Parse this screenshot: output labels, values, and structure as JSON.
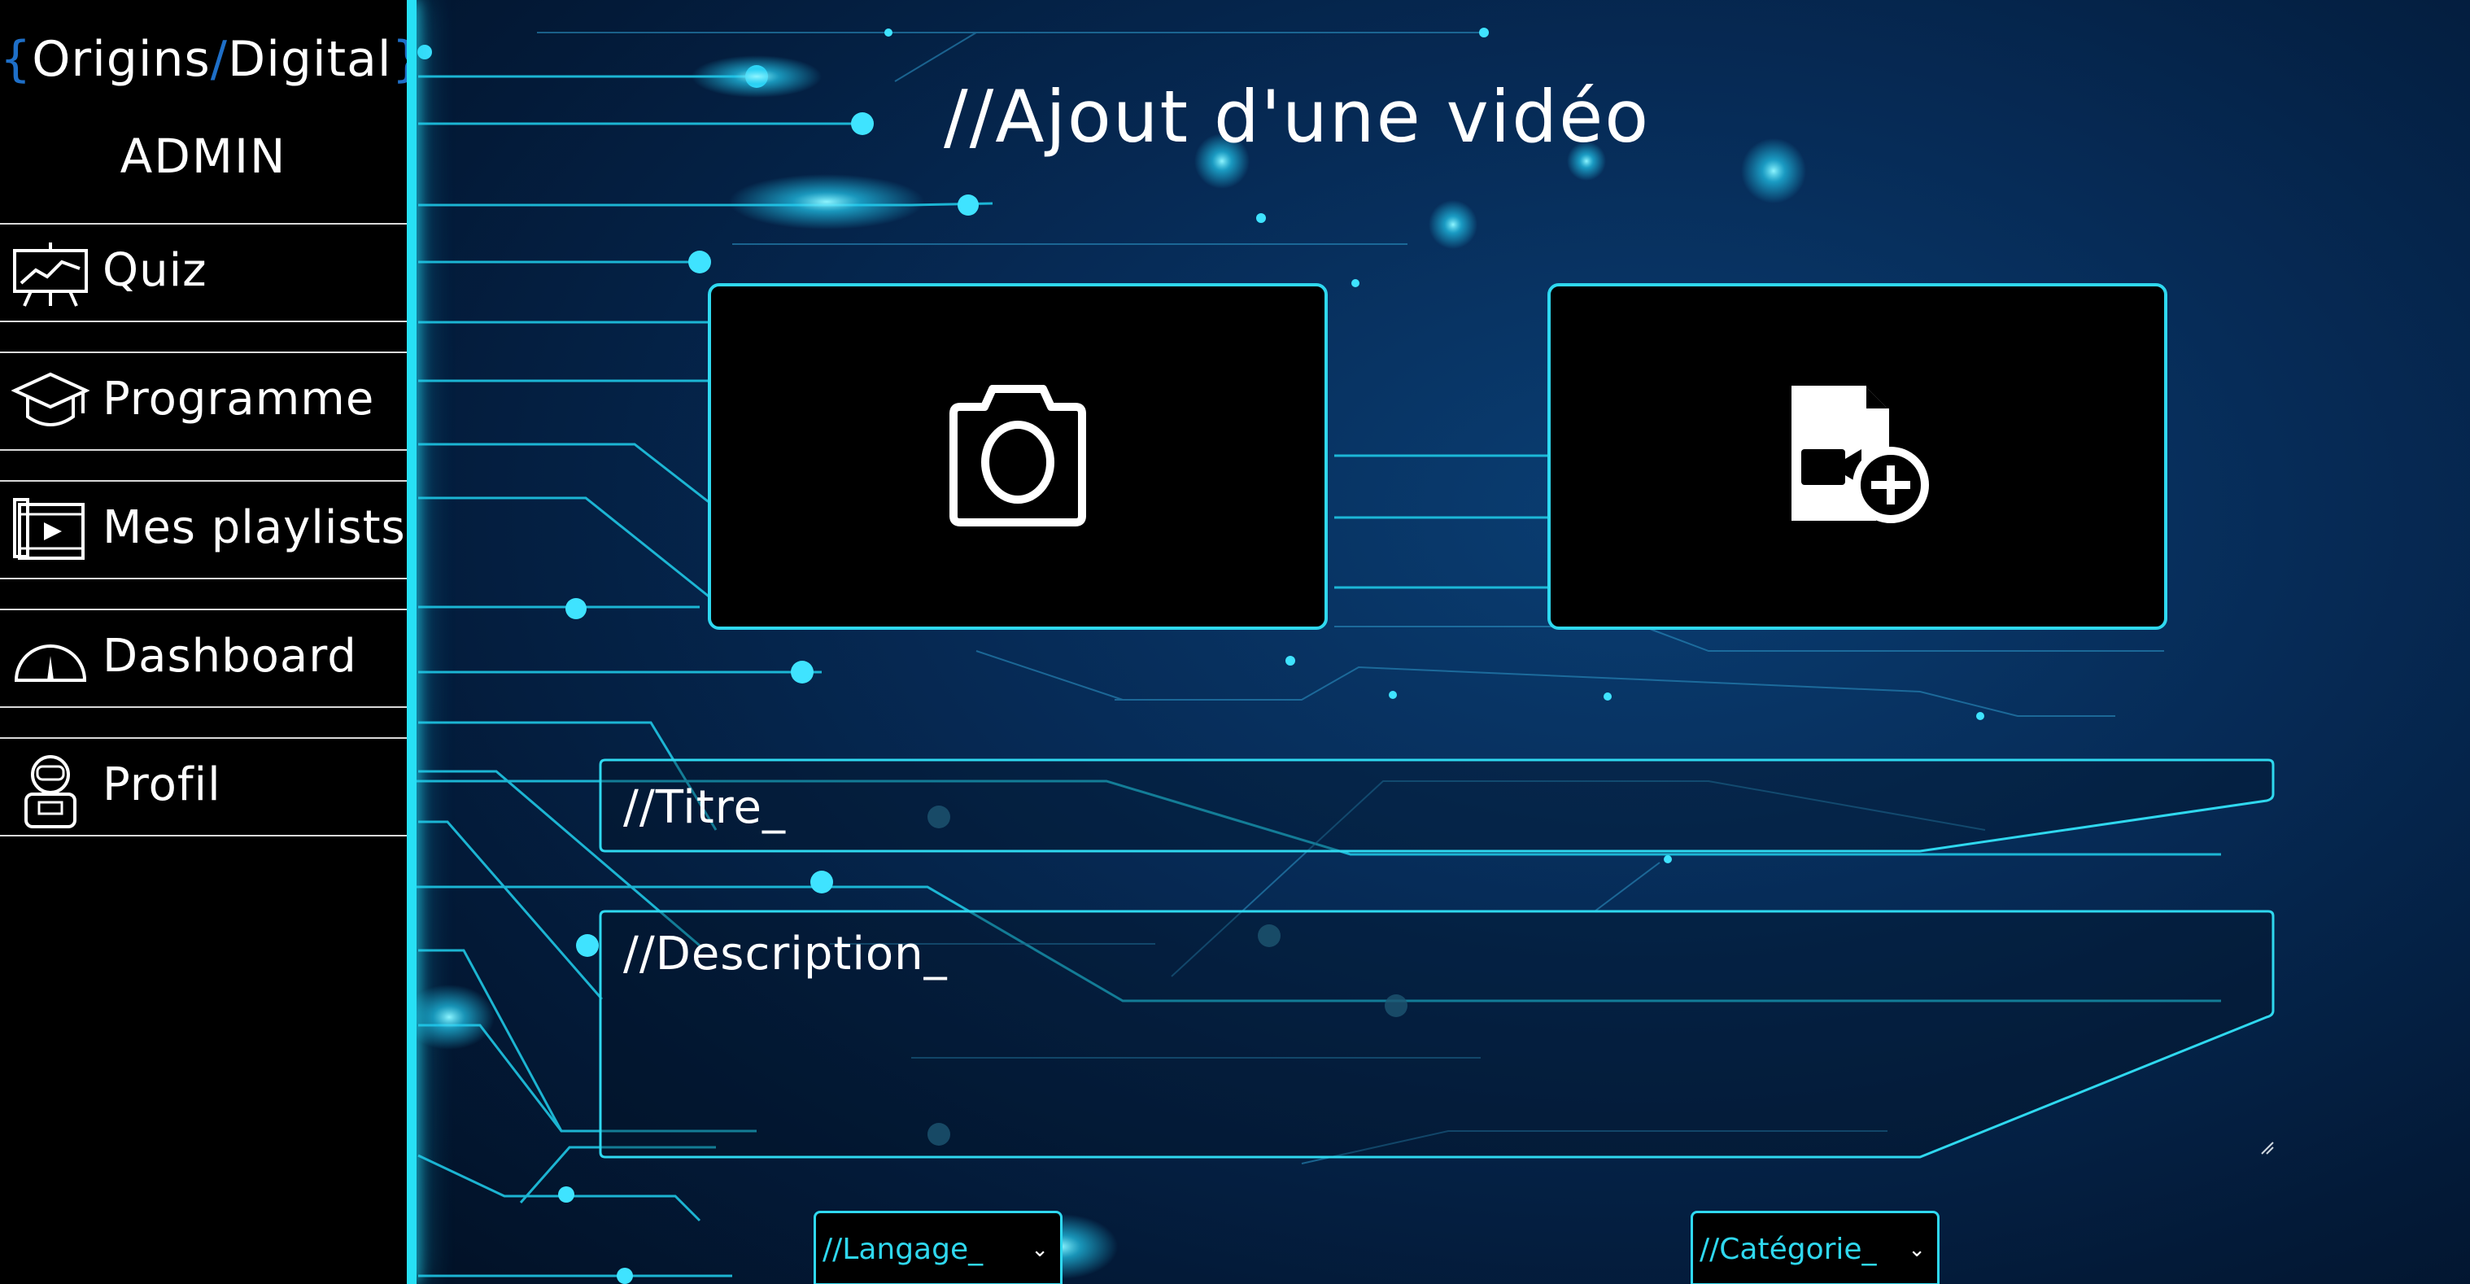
{
  "brand": {
    "brace_open": "{",
    "origins": "Origins",
    "slash": "/",
    "digital": "Digital",
    "brace_close": "}",
    "accent_color": "#1e6fc8"
  },
  "role": "ADMIN",
  "sidebar": {
    "items": [
      {
        "label": "Quiz",
        "icon": "presentation-chart-icon"
      },
      {
        "label": "Programme",
        "icon": "graduation-cap-icon"
      },
      {
        "label": "Mes playlists",
        "icon": "video-playlist-icon"
      },
      {
        "label": "Dashboard",
        "icon": "speedometer-icon"
      },
      {
        "label": "Profil",
        "icon": "astronaut-icon"
      }
    ]
  },
  "main": {
    "title": "//Ajout d'une vidéo",
    "upload_thumbnail_icon": "camera-icon",
    "upload_video_icon": "add-video-file-icon",
    "title_field": {
      "placeholder": "//Titre_"
    },
    "description_field": {
      "placeholder": "//Description_"
    },
    "language_select": {
      "value": "//Langage_"
    },
    "category_select": {
      "value": "//Catégorie_"
    }
  },
  "colors": {
    "accent_cyan": "#2fd8ef",
    "background_deep": "#031a38",
    "sidebar_bg": "#000000"
  }
}
